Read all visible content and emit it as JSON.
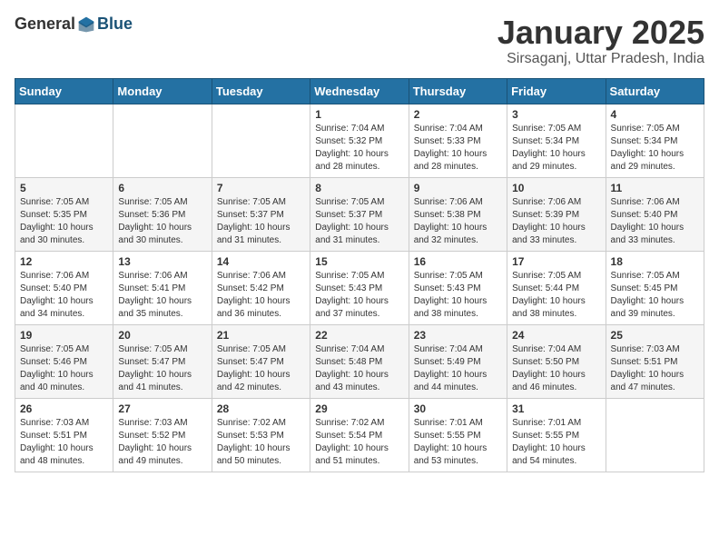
{
  "header": {
    "logo_general": "General",
    "logo_blue": "Blue",
    "title": "January 2025",
    "location": "Sirsaganj, Uttar Pradesh, India"
  },
  "weekdays": [
    "Sunday",
    "Monday",
    "Tuesday",
    "Wednesday",
    "Thursday",
    "Friday",
    "Saturday"
  ],
  "weeks": [
    [
      {
        "day": "",
        "content": ""
      },
      {
        "day": "",
        "content": ""
      },
      {
        "day": "",
        "content": ""
      },
      {
        "day": "1",
        "content": "Sunrise: 7:04 AM\nSunset: 5:32 PM\nDaylight: 10 hours\nand 28 minutes."
      },
      {
        "day": "2",
        "content": "Sunrise: 7:04 AM\nSunset: 5:33 PM\nDaylight: 10 hours\nand 28 minutes."
      },
      {
        "day": "3",
        "content": "Sunrise: 7:05 AM\nSunset: 5:34 PM\nDaylight: 10 hours\nand 29 minutes."
      },
      {
        "day": "4",
        "content": "Sunrise: 7:05 AM\nSunset: 5:34 PM\nDaylight: 10 hours\nand 29 minutes."
      }
    ],
    [
      {
        "day": "5",
        "content": "Sunrise: 7:05 AM\nSunset: 5:35 PM\nDaylight: 10 hours\nand 30 minutes."
      },
      {
        "day": "6",
        "content": "Sunrise: 7:05 AM\nSunset: 5:36 PM\nDaylight: 10 hours\nand 30 minutes."
      },
      {
        "day": "7",
        "content": "Sunrise: 7:05 AM\nSunset: 5:37 PM\nDaylight: 10 hours\nand 31 minutes."
      },
      {
        "day": "8",
        "content": "Sunrise: 7:05 AM\nSunset: 5:37 PM\nDaylight: 10 hours\nand 31 minutes."
      },
      {
        "day": "9",
        "content": "Sunrise: 7:06 AM\nSunset: 5:38 PM\nDaylight: 10 hours\nand 32 minutes."
      },
      {
        "day": "10",
        "content": "Sunrise: 7:06 AM\nSunset: 5:39 PM\nDaylight: 10 hours\nand 33 minutes."
      },
      {
        "day": "11",
        "content": "Sunrise: 7:06 AM\nSunset: 5:40 PM\nDaylight: 10 hours\nand 33 minutes."
      }
    ],
    [
      {
        "day": "12",
        "content": "Sunrise: 7:06 AM\nSunset: 5:40 PM\nDaylight: 10 hours\nand 34 minutes."
      },
      {
        "day": "13",
        "content": "Sunrise: 7:06 AM\nSunset: 5:41 PM\nDaylight: 10 hours\nand 35 minutes."
      },
      {
        "day": "14",
        "content": "Sunrise: 7:06 AM\nSunset: 5:42 PM\nDaylight: 10 hours\nand 36 minutes."
      },
      {
        "day": "15",
        "content": "Sunrise: 7:05 AM\nSunset: 5:43 PM\nDaylight: 10 hours\nand 37 minutes."
      },
      {
        "day": "16",
        "content": "Sunrise: 7:05 AM\nSunset: 5:43 PM\nDaylight: 10 hours\nand 38 minutes."
      },
      {
        "day": "17",
        "content": "Sunrise: 7:05 AM\nSunset: 5:44 PM\nDaylight: 10 hours\nand 38 minutes."
      },
      {
        "day": "18",
        "content": "Sunrise: 7:05 AM\nSunset: 5:45 PM\nDaylight: 10 hours\nand 39 minutes."
      }
    ],
    [
      {
        "day": "19",
        "content": "Sunrise: 7:05 AM\nSunset: 5:46 PM\nDaylight: 10 hours\nand 40 minutes."
      },
      {
        "day": "20",
        "content": "Sunrise: 7:05 AM\nSunset: 5:47 PM\nDaylight: 10 hours\nand 41 minutes."
      },
      {
        "day": "21",
        "content": "Sunrise: 7:05 AM\nSunset: 5:47 PM\nDaylight: 10 hours\nand 42 minutes."
      },
      {
        "day": "22",
        "content": "Sunrise: 7:04 AM\nSunset: 5:48 PM\nDaylight: 10 hours\nand 43 minutes."
      },
      {
        "day": "23",
        "content": "Sunrise: 7:04 AM\nSunset: 5:49 PM\nDaylight: 10 hours\nand 44 minutes."
      },
      {
        "day": "24",
        "content": "Sunrise: 7:04 AM\nSunset: 5:50 PM\nDaylight: 10 hours\nand 46 minutes."
      },
      {
        "day": "25",
        "content": "Sunrise: 7:03 AM\nSunset: 5:51 PM\nDaylight: 10 hours\nand 47 minutes."
      }
    ],
    [
      {
        "day": "26",
        "content": "Sunrise: 7:03 AM\nSunset: 5:51 PM\nDaylight: 10 hours\nand 48 minutes."
      },
      {
        "day": "27",
        "content": "Sunrise: 7:03 AM\nSunset: 5:52 PM\nDaylight: 10 hours\nand 49 minutes."
      },
      {
        "day": "28",
        "content": "Sunrise: 7:02 AM\nSunset: 5:53 PM\nDaylight: 10 hours\nand 50 minutes."
      },
      {
        "day": "29",
        "content": "Sunrise: 7:02 AM\nSunset: 5:54 PM\nDaylight: 10 hours\nand 51 minutes."
      },
      {
        "day": "30",
        "content": "Sunrise: 7:01 AM\nSunset: 5:55 PM\nDaylight: 10 hours\nand 53 minutes."
      },
      {
        "day": "31",
        "content": "Sunrise: 7:01 AM\nSunset: 5:55 PM\nDaylight: 10 hours\nand 54 minutes."
      },
      {
        "day": "",
        "content": ""
      }
    ]
  ]
}
